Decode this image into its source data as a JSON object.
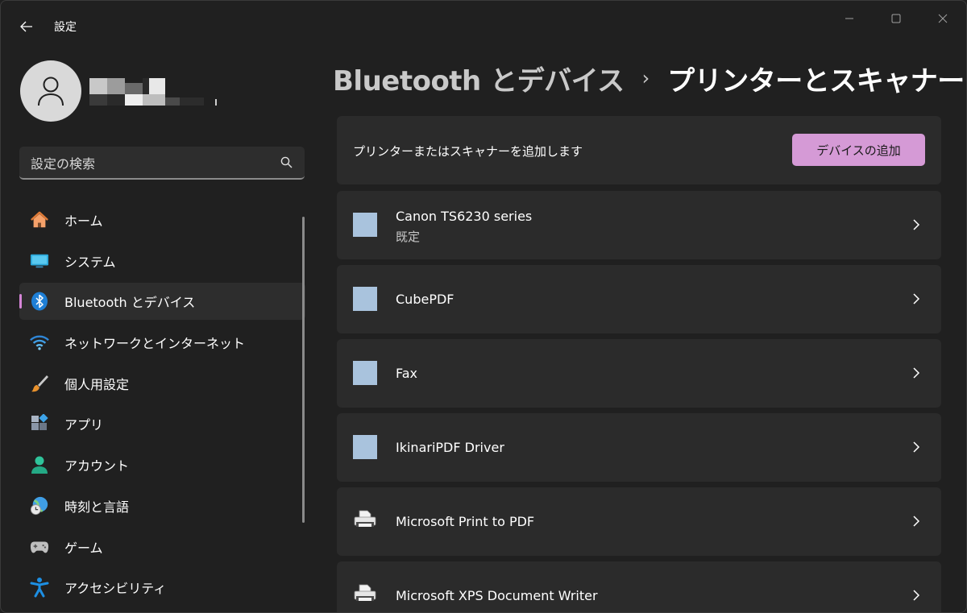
{
  "window": {
    "title": "設定"
  },
  "sidebar": {
    "search_placeholder": "設定の検索",
    "items": [
      {
        "label": "ホーム",
        "icon": "home-icon"
      },
      {
        "label": "システム",
        "icon": "system-icon"
      },
      {
        "label": "Bluetooth とデバイス",
        "icon": "bluetooth-icon",
        "active": true
      },
      {
        "label": "ネットワークとインターネット",
        "icon": "wifi-icon"
      },
      {
        "label": "個人用設定",
        "icon": "brush-icon"
      },
      {
        "label": "アプリ",
        "icon": "apps-icon"
      },
      {
        "label": "アカウント",
        "icon": "account-icon"
      },
      {
        "label": "時刻と言語",
        "icon": "globe-clock-icon"
      },
      {
        "label": "ゲーム",
        "icon": "gamepad-icon"
      },
      {
        "label": "アクセシビリティ",
        "icon": "accessibility-icon"
      }
    ]
  },
  "main": {
    "breadcrumb_parent": "Bluetooth とデバイス",
    "breadcrumb_separator": "›",
    "page_title": "プリンターとスキャナー",
    "add_section": {
      "text": "プリンターまたはスキャナーを追加します",
      "button_label": "デバイスの追加"
    },
    "devices": [
      {
        "name": "Canon TS6230 series",
        "status": "既定",
        "icon": "printer-square-icon"
      },
      {
        "name": "CubePDF",
        "status": "",
        "icon": "printer-square-icon"
      },
      {
        "name": "Fax",
        "status": "",
        "icon": "printer-square-icon"
      },
      {
        "name": "IkinariPDF Driver",
        "status": "",
        "icon": "printer-square-icon"
      },
      {
        "name": "Microsoft Print to PDF",
        "status": "",
        "icon": "printer-icon"
      },
      {
        "name": "Microsoft XPS Document Writer",
        "status": "",
        "icon": "printer-icon"
      }
    ]
  },
  "colors": {
    "accent": "#d59ad6",
    "background": "#202020",
    "card": "#2b2b2b"
  }
}
